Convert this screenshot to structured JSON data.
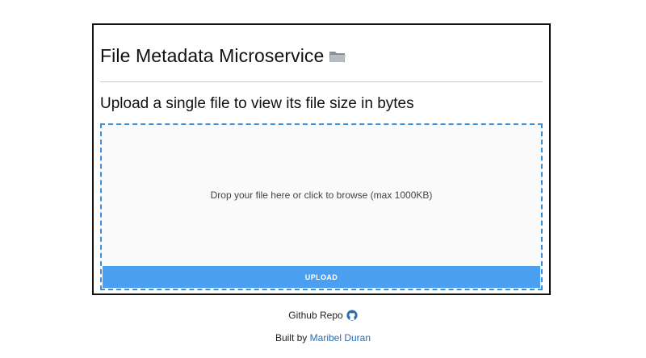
{
  "card": {
    "title": "File Metadata Microservice",
    "title_icon": "folder-icon",
    "subtitle": "Upload a single file to view its file size in bytes",
    "dropzone_text": "Drop your file here or click to browse (max 1000KB)",
    "upload_label": "UPLOAD"
  },
  "footer": {
    "repo_label": "Github Repo",
    "repo_icon": "github-icon",
    "built_prefix": "Built by",
    "author": "Maribel Duran"
  },
  "colors": {
    "accent": "#4a9ff0",
    "dropzone_border": "#3b8fdc",
    "link": "#2b6cb0"
  }
}
